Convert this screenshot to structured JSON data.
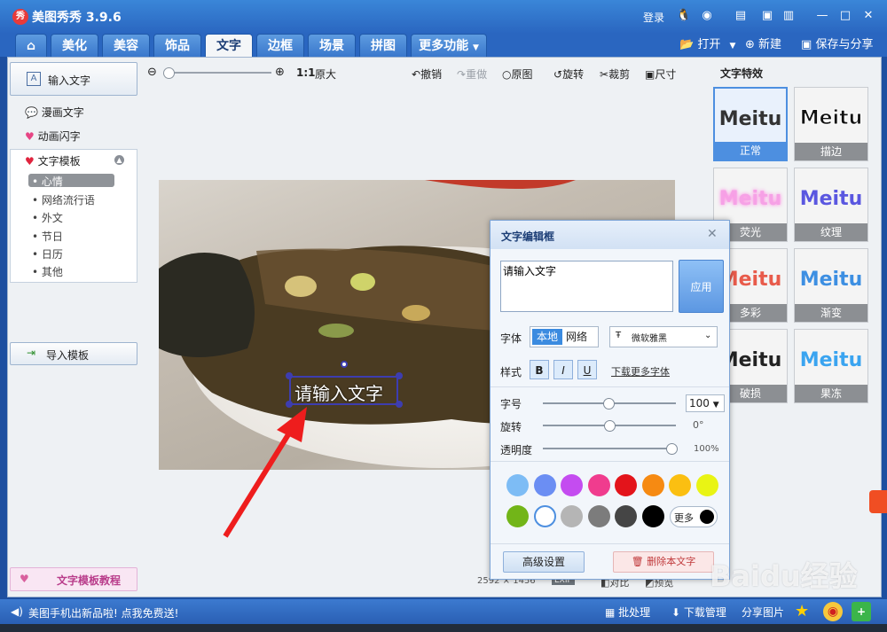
{
  "app": {
    "title": "美图秀秀 3.9.6",
    "logo_text": "秀",
    "login": "登录"
  },
  "tabs": [
    "美化",
    "美容",
    "饰品",
    "文字",
    "边框",
    "场景",
    "拼图",
    "更多功能"
  ],
  "active_tab": "文字",
  "file_actions": {
    "open": "打开",
    "new": "新建",
    "save": "保存与分享"
  },
  "left_panel": {
    "input_text": "输入文字",
    "comic_text": "漫画文字",
    "animated_text": "动画闪字",
    "template_header": "文字模板",
    "template_items": [
      "心情",
      "网络流行语",
      "外文",
      "节日",
      "日历",
      "其他"
    ],
    "selected_template": "心情",
    "import_template": "导入模板",
    "tutorial": "文字模板教程"
  },
  "toolbar": {
    "zoom_ratio": "1:1",
    "original_size": "原大",
    "undo": "撤销",
    "redo": "重做",
    "original": "原图",
    "rotate": "旋转",
    "crop": "裁剪",
    "size": "尺寸"
  },
  "canvas": {
    "text_placeholder": "请输入文字",
    "width": "2592",
    "times": "×",
    "height": "1456",
    "exif": "EXIF",
    "compare": "对比",
    "preview": "预览"
  },
  "effects": {
    "header": "文字特效",
    "sample": "Meitu",
    "items": [
      {
        "label": "正常",
        "color": "#333333"
      },
      {
        "label": "描边",
        "color": "#111111"
      },
      {
        "label": "荧光",
        "color": "#f6a1e6"
      },
      {
        "label": "纹理",
        "color": "#5a57e0"
      },
      {
        "label": "多彩",
        "color": "#e85b4b"
      },
      {
        "label": "渐变",
        "color": "#3d8fe2"
      },
      {
        "label": "破损",
        "color": "#222222"
      },
      {
        "label": "果冻",
        "color": "#3aa4f0"
      }
    ]
  },
  "dialog": {
    "title": "文字编辑框",
    "text_value": "请输入文字",
    "apply": "应用",
    "font_label": "字体",
    "font_local": "本地",
    "font_network": "网络",
    "font_selected": "微软雅黑",
    "style_label": "样式",
    "bold": "B",
    "italic": "I",
    "underline": "U",
    "download_fonts": "下载更多字体",
    "size_label": "字号",
    "size_value": "100",
    "rotate_label": "旋转",
    "rotate_value": "0°",
    "opacity_label": "透明度",
    "opacity_value": "100%",
    "more_colors": "更多",
    "advanced": "高级设置",
    "delete": "删除本文字"
  },
  "palette": [
    "#7dbcf5",
    "#6b8ef3",
    "#c44cf0",
    "#f03c8e",
    "#e3141b",
    "#f68a12",
    "#fbbf11",
    "#e9f414",
    "#72b518",
    "#ffffff",
    "#b5b5b5",
    "#7c7c7c",
    "#454545",
    "#000000"
  ],
  "status": {
    "promo": "美图手机出新品啦! 点我免费送!",
    "batch": "批处理",
    "download_mgr": "下载管理",
    "share_image": "分享图片"
  },
  "watermark": "Baidu经验"
}
